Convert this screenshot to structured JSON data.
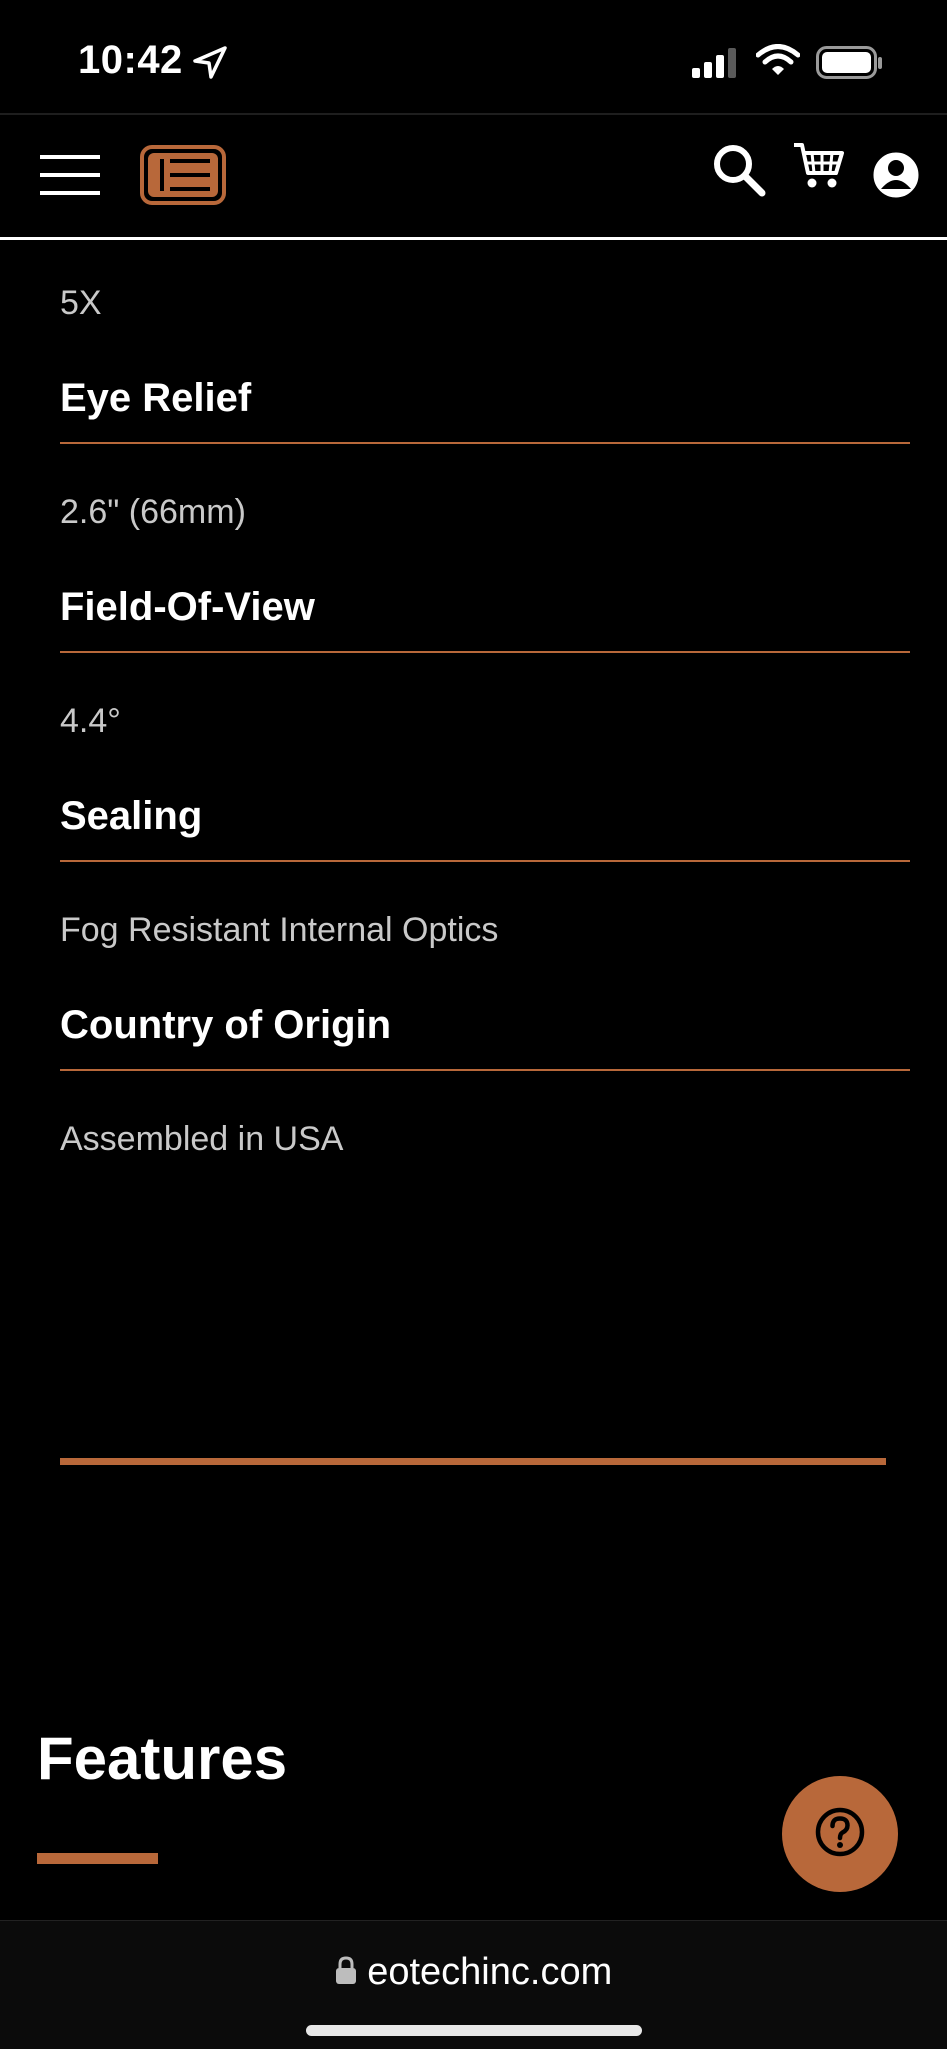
{
  "status_bar": {
    "time": "10:42"
  },
  "navbar": {
    "icons": [
      "menu-icon",
      "eotech-logo-icon",
      "search-icon",
      "cart-icon",
      "account-icon"
    ]
  },
  "specs": [
    {
      "value": "5X"
    },
    {
      "heading": "Eye Relief",
      "value": "2.6\" (66mm)"
    },
    {
      "heading": "Field-Of-View",
      "value": "4.4°"
    },
    {
      "heading": "Sealing",
      "value": "Fog Resistant Internal Optics"
    },
    {
      "heading": "Country of Origin",
      "value": "Assembled in USA"
    }
  ],
  "features": {
    "title": "Features"
  },
  "help": {
    "icon": "question-mark-icon"
  },
  "browser": {
    "url": "eotechinc.com"
  },
  "colors": {
    "accent": "#b8683a",
    "background": "#000000",
    "text_muted": "#c9c9c9"
  }
}
